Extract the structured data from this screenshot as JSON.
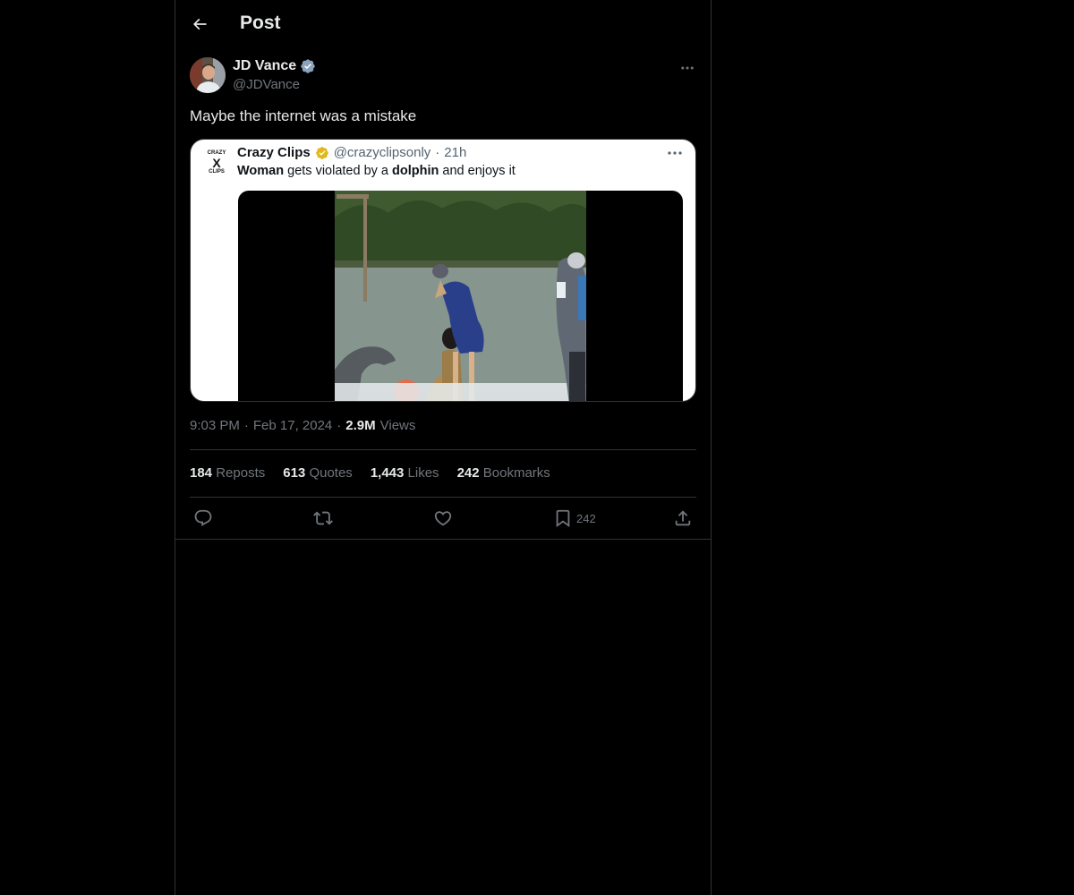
{
  "header": {
    "title": "Post"
  },
  "post": {
    "author_name": "JD Vance",
    "author_handle": "@JDVance",
    "text": "Maybe the internet was a mistake",
    "time": "9:03 PM",
    "date": "Feb 17, 2024",
    "views_count": "2.9M",
    "views_label": "Views",
    "separator": "·"
  },
  "quoted": {
    "avatar_top": "CRAZY",
    "avatar_mid": "X",
    "avatar_bottom": "CLIPS",
    "name": "Crazy Clips",
    "handle": "@crazyclipsonly",
    "age": "21h",
    "text_word1": "Woman",
    "text_part1": " gets violated by a ",
    "text_word2": "dolphin",
    "text_part2": " and enjoys it"
  },
  "stats": [
    {
      "count": "184",
      "label": "Reposts"
    },
    {
      "count": "613",
      "label": "Quotes"
    },
    {
      "count": "1,443",
      "label": "Likes"
    },
    {
      "count": "242",
      "label": "Bookmarks"
    }
  ],
  "actions": {
    "bookmark_count": "242"
  },
  "colors": {
    "background": "#000000",
    "border": "#2f3336",
    "text_primary": "#e7e9ea",
    "text_secondary": "#71767b",
    "verified_blue": "#1d9bf0",
    "verified_gold": "#e2b719"
  }
}
